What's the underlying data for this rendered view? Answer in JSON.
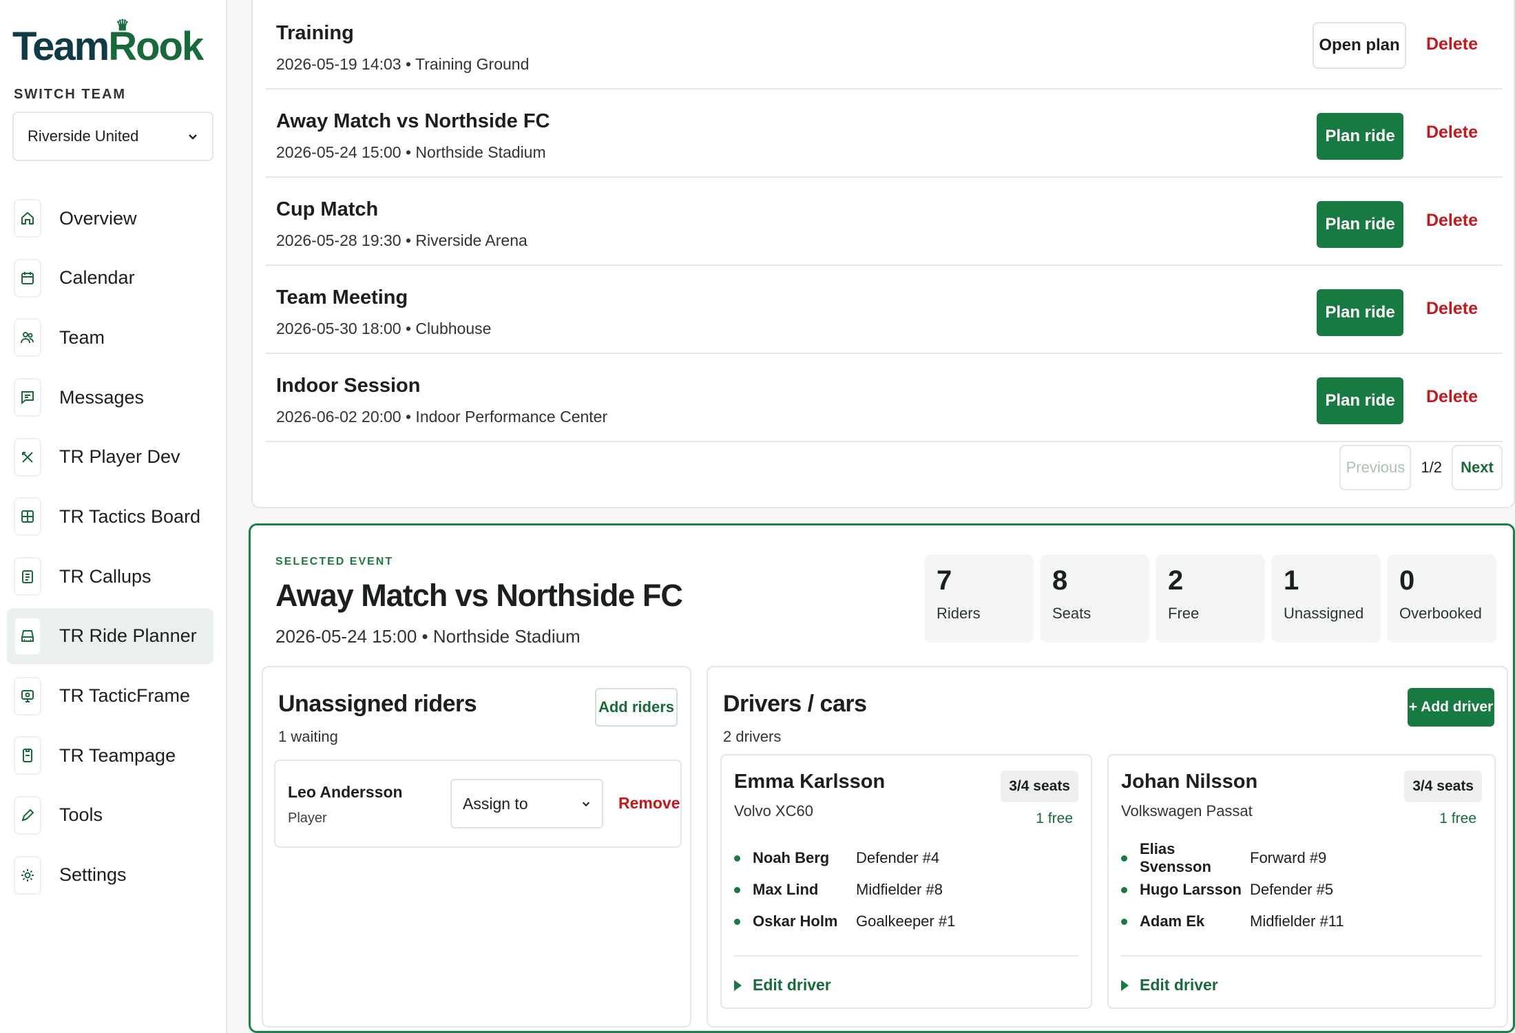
{
  "brand": {
    "part1": "Team",
    "part2": "Rook",
    "crown": "♛"
  },
  "sidebar": {
    "switch_label": "SWITCH TEAM",
    "team_value": "Riverside United",
    "items": [
      {
        "label": "Overview",
        "icon": "home-icon"
      },
      {
        "label": "Calendar",
        "icon": "calendar-icon"
      },
      {
        "label": "Team",
        "icon": "users-icon"
      },
      {
        "label": "Messages",
        "icon": "message-icon"
      },
      {
        "label": "TR Player Dev",
        "icon": "tools-cross-icon"
      },
      {
        "label": "TR Tactics Board",
        "icon": "board-icon"
      },
      {
        "label": "TR Callups",
        "icon": "clipboard-icon"
      },
      {
        "label": "TR Ride Planner",
        "icon": "car-icon"
      },
      {
        "label": "TR TacticFrame",
        "icon": "monitor-icon"
      },
      {
        "label": "TR Teampage",
        "icon": "page-icon"
      },
      {
        "label": "Tools",
        "icon": "pen-icon"
      },
      {
        "label": "Settings",
        "icon": "gear-icon"
      }
    ]
  },
  "events": {
    "rows": [
      {
        "title": "Training",
        "meta": "2026-05-19 14:03 • Training Ground",
        "action": "Open plan",
        "delete": "Delete"
      },
      {
        "title": "Away Match vs Northside FC",
        "meta": "2026-05-24 15:00 • Northside Stadium",
        "action": "Plan ride",
        "delete": "Delete"
      },
      {
        "title": "Cup Match",
        "meta": "2026-05-28 19:30 • Riverside Arena",
        "action": "Plan ride",
        "delete": "Delete"
      },
      {
        "title": "Team Meeting",
        "meta": "2026-05-30 18:00 • Clubhouse",
        "action": "Plan ride",
        "delete": "Delete"
      },
      {
        "title": "Indoor Session",
        "meta": "2026-06-02 20:00 • Indoor Performance Center",
        "action": "Plan ride",
        "delete": "Delete"
      }
    ],
    "pager": {
      "previous": "Previous",
      "info": "1/2",
      "next": "Next"
    }
  },
  "selected": {
    "tag": "SELECTED EVENT",
    "title": "Away Match vs Northside FC",
    "meta": "2026-05-24 15:00 • Northside Stadium",
    "stats": [
      {
        "value": "7",
        "label": "Riders"
      },
      {
        "value": "8",
        "label": "Seats"
      },
      {
        "value": "2",
        "label": "Free"
      },
      {
        "value": "1",
        "label": "Unassigned"
      },
      {
        "value": "0",
        "label": "Overbooked"
      }
    ],
    "unassigned": {
      "title": "Unassigned riders",
      "sub": "1 waiting",
      "add_button": "Add riders",
      "rider": {
        "name": "Leo Andersson",
        "role": "Player",
        "assign": "Assign to",
        "remove": "Remove"
      }
    },
    "drivers": {
      "title": "Drivers / cars",
      "sub": "2 drivers",
      "add_button": "+ Add driver",
      "cars": [
        {
          "name": "Emma Karlsson",
          "model": "Volvo XC60",
          "seats": "3/4 seats",
          "free": "1 free",
          "passengers": [
            {
              "name": "Noah Berg",
              "role": "Defender #4"
            },
            {
              "name": "Max Lind",
              "role": "Midfielder #8"
            },
            {
              "name": "Oskar Holm",
              "role": "Goalkeeper #1"
            }
          ],
          "edit": "Edit driver"
        },
        {
          "name": "Johan Nilsson",
          "model": "Volkswagen Passat",
          "seats": "3/4 seats",
          "free": "1 free",
          "passengers": [
            {
              "name": "Elias Svensson",
              "role": "Forward #9"
            },
            {
              "name": "Hugo Larsson",
              "role": "Defender #5"
            },
            {
              "name": "Adam Ek",
              "role": "Midfielder #11"
            }
          ],
          "edit": "Edit driver"
        }
      ]
    }
  },
  "colors": {
    "accent": "#177a40",
    "danger": "#c8161d",
    "brand_dark": "#0e3b47"
  }
}
